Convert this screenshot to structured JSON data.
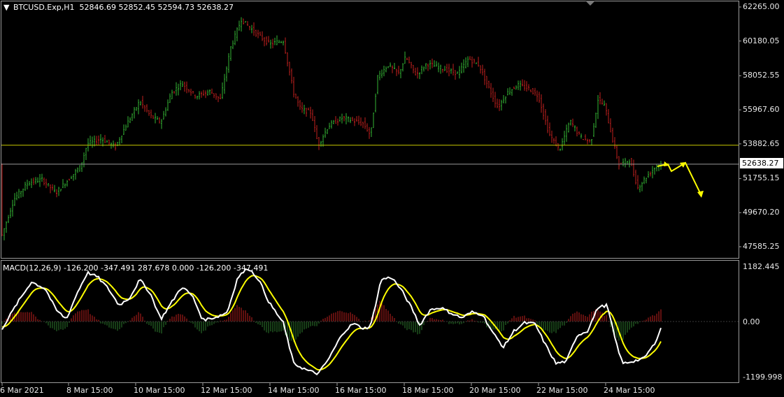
{
  "header": {
    "symbol": "BTCUSD.Exp,H1",
    "ohlc": "52846.69 52852.45 52594.73 52638.27"
  },
  "macd_header": "MACD(12,26,9) -126.200 -347.491 287.678 0.000 -126.200 -347.491",
  "price_axis": [
    "62265.00",
    "60180.05",
    "58052.55",
    "55967.60",
    "53882.65",
    "51755.15",
    "49670.20",
    "47585.25"
  ],
  "current_price": "52638.27",
  "macd_axis": [
    "1182.445",
    "0.00",
    "-1199.998"
  ],
  "time_axis": [
    "6 Mar 2021",
    "8 Mar 15:00",
    "10 Mar 15:00",
    "12 Mar 15:00",
    "14 Mar 15:00",
    "16 Mar 15:00",
    "18 Mar 15:00",
    "20 Mar 15:00",
    "22 Mar 15:00",
    "24 Mar 15:00"
  ],
  "levels": {
    "support_price": 53800,
    "current_price": 52638.27
  },
  "colors": {
    "background": "#000000",
    "bull": "#35b535",
    "bear": "#c0201e",
    "macd_line": "#ffffff",
    "signal_line": "#ffff00",
    "hist_pos": "#c0201e",
    "hist_neg": "#2e7d2e",
    "support_line": "#c8c800",
    "current_line": "#9a9a9a",
    "arrow": "#ffff00"
  },
  "icons": {
    "menu": "triangle-down-icon",
    "scroll": "triangle-down-marker-icon"
  }
}
